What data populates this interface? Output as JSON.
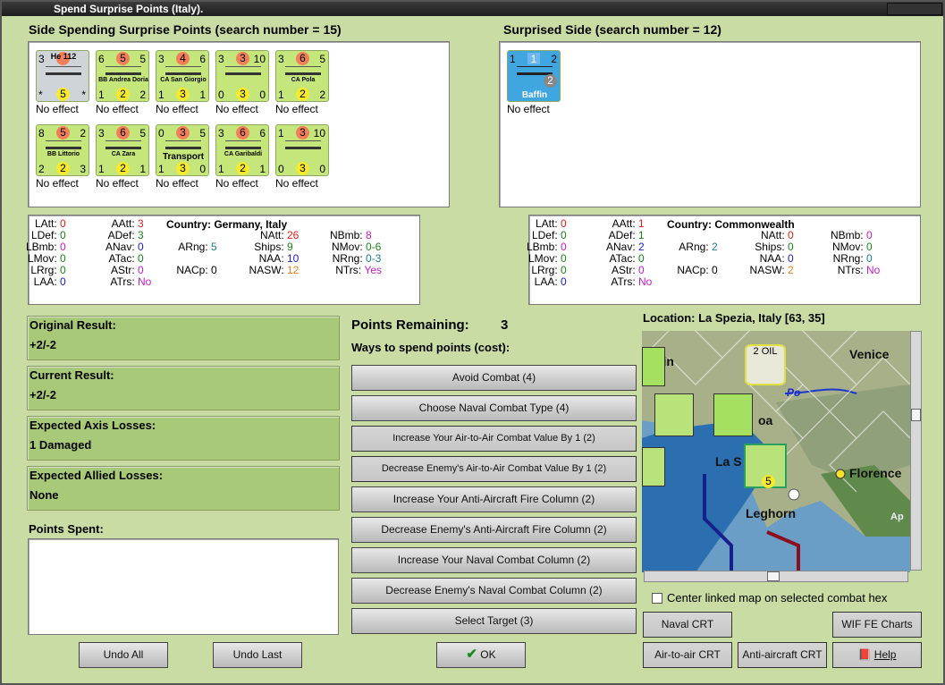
{
  "window": {
    "title": "Spend Surprise Points (Italy)."
  },
  "left_side": {
    "header": "Side Spending Surprise Points (search number = 15)",
    "units": [
      {
        "name": "He 112",
        "tl": "3",
        "tm": "",
        "tr": "",
        "bl": "*",
        "bm": "5",
        "br": "*",
        "effect": "No effect",
        "kind": "air"
      },
      {
        "name": "BB Andrea Doria",
        "tl": "6",
        "tm": "5",
        "tr": "5",
        "bl": "1",
        "bm": "2",
        "br": "2",
        "effect": "No effect",
        "kind": "ship"
      },
      {
        "name": "CA San Giorgio",
        "tl": "3",
        "tm": "4",
        "tr": "6",
        "bl": "1",
        "bm": "3",
        "br": "1",
        "effect": "No effect",
        "kind": "ship"
      },
      {
        "name": "",
        "tl": "3",
        "tm": "3",
        "tr": "10",
        "bl": "0",
        "bm": "3",
        "br": "0",
        "effect": "No effect",
        "kind": "carrier"
      },
      {
        "name": "CA Pola",
        "tl": "3",
        "tm": "6",
        "tr": "5",
        "bl": "1",
        "bm": "2",
        "br": "2",
        "effect": "No effect",
        "kind": "ship"
      },
      {
        "name": "BB Littorio",
        "tl": "8",
        "tm": "5",
        "tr": "2",
        "bl": "2",
        "bm": "2",
        "br": "3",
        "effect": "No effect",
        "kind": "ship"
      },
      {
        "name": "CA Zara",
        "tl": "3",
        "tm": "6",
        "tr": "5",
        "bl": "1",
        "bm": "2",
        "br": "1",
        "effect": "No effect",
        "kind": "ship"
      },
      {
        "name": "Transport",
        "tl": "0",
        "tm": "3",
        "tr": "5",
        "bl": "1",
        "bm": "3",
        "br": "0",
        "effect": "No effect",
        "kind": "transport"
      },
      {
        "name": "CA Garibaldi",
        "tl": "3",
        "tm": "6",
        "tr": "6",
        "bl": "1",
        "bm": "2",
        "br": "1",
        "effect": "No effect",
        "kind": "ship"
      },
      {
        "name": "",
        "tl": "1",
        "tm": "3",
        "tr": "10",
        "bl": "0",
        "bm": "3",
        "br": "0",
        "effect": "No effect",
        "kind": "carrier"
      }
    ],
    "country_label": "Country: Germany, Italy",
    "stats": [
      {
        "k": "LAtt:",
        "v": "0",
        "c": "#e02020"
      },
      {
        "k": "LDef:",
        "v": "0",
        "c": "#208020"
      },
      {
        "k": "LBmb:",
        "v": "0",
        "c": "#c020c0"
      },
      {
        "k": "LMov:",
        "v": "0",
        "c": "#208020"
      },
      {
        "k": "LRrg:",
        "v": "0",
        "c": "#208020"
      },
      {
        "k": "LAA:",
        "v": "0",
        "c": "#2020c0"
      },
      {
        "k": "AAtt:",
        "v": "3",
        "c": "#e02020"
      },
      {
        "k": "ADef:",
        "v": "3",
        "c": "#208020"
      },
      {
        "k": "ANav:",
        "v": "0",
        "c": "#2020c0"
      },
      {
        "k": "ATac:",
        "v": "0",
        "c": "#208020"
      },
      {
        "k": "AStr:",
        "v": "0",
        "c": "#c020c0"
      },
      {
        "k": "ATrs:",
        "v": "No",
        "c": "#c020c0"
      },
      {
        "k": "ARng:",
        "v": "5",
        "c": "#208080"
      },
      {
        "k": "NACp:",
        "v": "0",
        "c": "#000"
      },
      {
        "k": "NAtt:",
        "v": "26",
        "c": "#e02020"
      },
      {
        "k": "Ships:",
        "v": "9",
        "c": "#208020"
      },
      {
        "k": "NAA:",
        "v": "10",
        "c": "#2020c0"
      },
      {
        "k": "NASW:",
        "v": "12",
        "c": "#e08020"
      },
      {
        "k": "NBmb:",
        "v": "8",
        "c": "#c020c0"
      },
      {
        "k": "NMov:",
        "v": "0-6",
        "c": "#208020"
      },
      {
        "k": "NRng:",
        "v": "0-3",
        "c": "#208080"
      },
      {
        "k": "NTrs:",
        "v": "Yes",
        "c": "#c020c0"
      }
    ]
  },
  "right_side": {
    "header": "Surprised Side (search number = 12)",
    "units": [
      {
        "name": "Baffin",
        "tl": "1",
        "tm": "1",
        "tr": "2",
        "mid": "2",
        "effect": "No effect"
      }
    ],
    "country_label": "Country: Commonwealth",
    "stats": [
      {
        "k": "LAtt:",
        "v": "0",
        "c": "#e02020"
      },
      {
        "k": "LDef:",
        "v": "0",
        "c": "#208020"
      },
      {
        "k": "LBmb:",
        "v": "0",
        "c": "#c020c0"
      },
      {
        "k": "LMov:",
        "v": "0",
        "c": "#208020"
      },
      {
        "k": "LRrg:",
        "v": "0",
        "c": "#208020"
      },
      {
        "k": "LAA:",
        "v": "0",
        "c": "#2020c0"
      },
      {
        "k": "AAtt:",
        "v": "1",
        "c": "#e02020"
      },
      {
        "k": "ADef:",
        "v": "1",
        "c": "#208020"
      },
      {
        "k": "ANav:",
        "v": "2",
        "c": "#2020c0"
      },
      {
        "k": "ATac:",
        "v": "0",
        "c": "#208020"
      },
      {
        "k": "AStr:",
        "v": "0",
        "c": "#c020c0"
      },
      {
        "k": "ATrs:",
        "v": "No",
        "c": "#c020c0"
      },
      {
        "k": "ARng:",
        "v": "2",
        "c": "#208080"
      },
      {
        "k": "NACp:",
        "v": "0",
        "c": "#000"
      },
      {
        "k": "NAtt:",
        "v": "0",
        "c": "#e02020"
      },
      {
        "k": "Ships:",
        "v": "0",
        "c": "#208020"
      },
      {
        "k": "NAA:",
        "v": "0",
        "c": "#2020c0"
      },
      {
        "k": "NASW:",
        "v": "2",
        "c": "#e08020"
      },
      {
        "k": "NBmb:",
        "v": "0",
        "c": "#c020c0"
      },
      {
        "k": "NMov:",
        "v": "0",
        "c": "#208020"
      },
      {
        "k": "NRng:",
        "v": "0",
        "c": "#208080"
      },
      {
        "k": "NTrs:",
        "v": "No",
        "c": "#c020c0"
      }
    ]
  },
  "results": {
    "original_title": "Original Result:",
    "original_value": "+2/-2",
    "current_title": "Current Result:",
    "current_value": "+2/-2",
    "axis_title": "Expected Axis Losses:",
    "axis_value": "1 Damaged",
    "allied_title": "Expected Allied Losses:",
    "allied_value": "None",
    "spent_title": "Points Spent:"
  },
  "points": {
    "remaining_label": "Points Remaining:",
    "remaining_value": "3",
    "ways_label": "Ways to spend points (cost):"
  },
  "options": [
    "Avoid Combat (4)",
    "Choose Naval Combat Type (4)",
    "Increase Your Air-to-Air Combat Value By 1 (2)",
    "Decrease Enemy's Air-to-Air Combat Value By 1 (2)",
    "Increase Your Anti-Aircraft Fire Column (2)",
    "Decrease Enemy's Anti-Aircraft Fire Column (2)",
    "Increase Your Naval Combat Column (2)",
    "Decrease Enemy's Naval Combat Column (2)",
    "Select Target (3)"
  ],
  "buttons": {
    "undo_all": "Undo All",
    "undo_last": "Undo Last",
    "ok": "OK",
    "naval_crt": "Naval CRT",
    "wif_charts": "WIF FE Charts",
    "air_crt": "Air-to-air CRT",
    "aa_crt": "Anti-aircraft CRT",
    "help": "Help"
  },
  "map": {
    "location": "Location: La Spezia, Italy [63, 35]",
    "labels": [
      "Venice",
      "2 OIL",
      "Po",
      "Florence",
      "La S",
      "Leghorn",
      "rin",
      "oa",
      "Ap"
    ],
    "center_label": "Center linked map on selected combat hex",
    "center_checked": false
  }
}
